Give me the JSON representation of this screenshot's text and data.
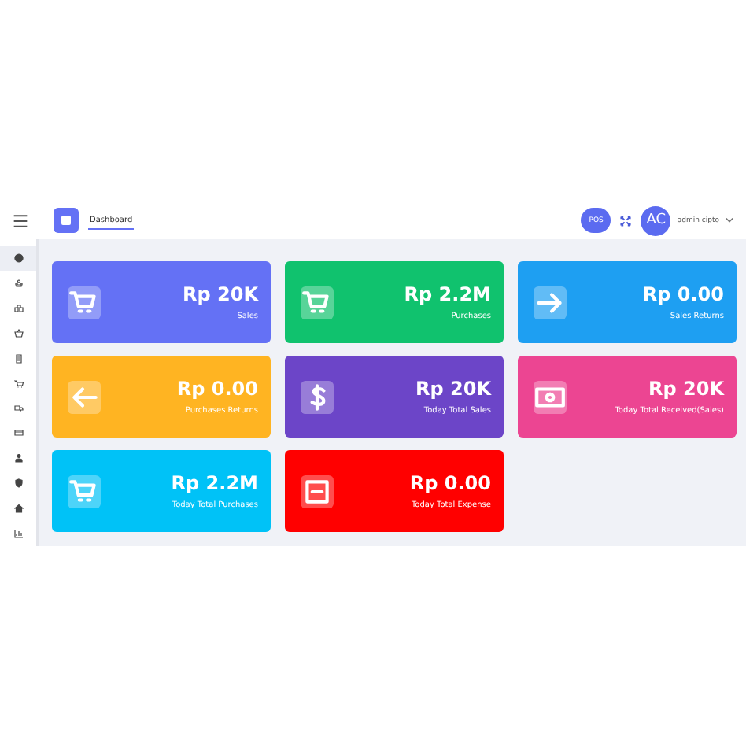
{
  "header": {
    "page_tab": "Dashboard",
    "pos_button": "POS",
    "avatar": "AC",
    "user_name": "admin cipto"
  },
  "sidebar": {
    "items": [
      {
        "kind": "gauge",
        "selected": true
      },
      {
        "kind": "users",
        "selected": false
      },
      {
        "kind": "boxes",
        "selected": false
      },
      {
        "kind": "basket",
        "selected": false
      },
      {
        "kind": "file",
        "selected": false
      },
      {
        "kind": "cart",
        "selected": false
      },
      {
        "kind": "truck",
        "selected": false
      },
      {
        "kind": "card",
        "selected": false
      },
      {
        "kind": "user",
        "selected": false
      },
      {
        "kind": "shield",
        "selected": false
      },
      {
        "kind": "home",
        "selected": false
      },
      {
        "kind": "chart",
        "selected": false
      }
    ]
  },
  "cards": [
    {
      "value": "Rp 20K",
      "label": "Sales",
      "kind": "cart",
      "color": "#6471f5"
    },
    {
      "value": "Rp 2.2M",
      "label": "Purchases",
      "kind": "cart",
      "color": "#10c26e"
    },
    {
      "value": "Rp 0.00",
      "label": "Sales Returns",
      "kind": "arrow-right",
      "color": "#1e9ff2"
    },
    {
      "value": "Rp 0.00",
      "label": "Purchases Returns",
      "kind": "arrow-left",
      "color": "#ffb422"
    },
    {
      "value": "Rp 20K",
      "label": "Today Total Sales",
      "kind": "dollar",
      "color": "#6c45c8"
    },
    {
      "value": "Rp 20K",
      "label": "Today Total Received(Sales)",
      "kind": "cash",
      "color": "#ec4592"
    },
    {
      "value": "Rp 2.2M",
      "label": "Today Total Purchases",
      "kind": "cart",
      "color": "#00c2f7"
    },
    {
      "value": "Rp 0.00",
      "label": "Today Total Expense",
      "kind": "minus",
      "color": "#ff0000"
    }
  ]
}
